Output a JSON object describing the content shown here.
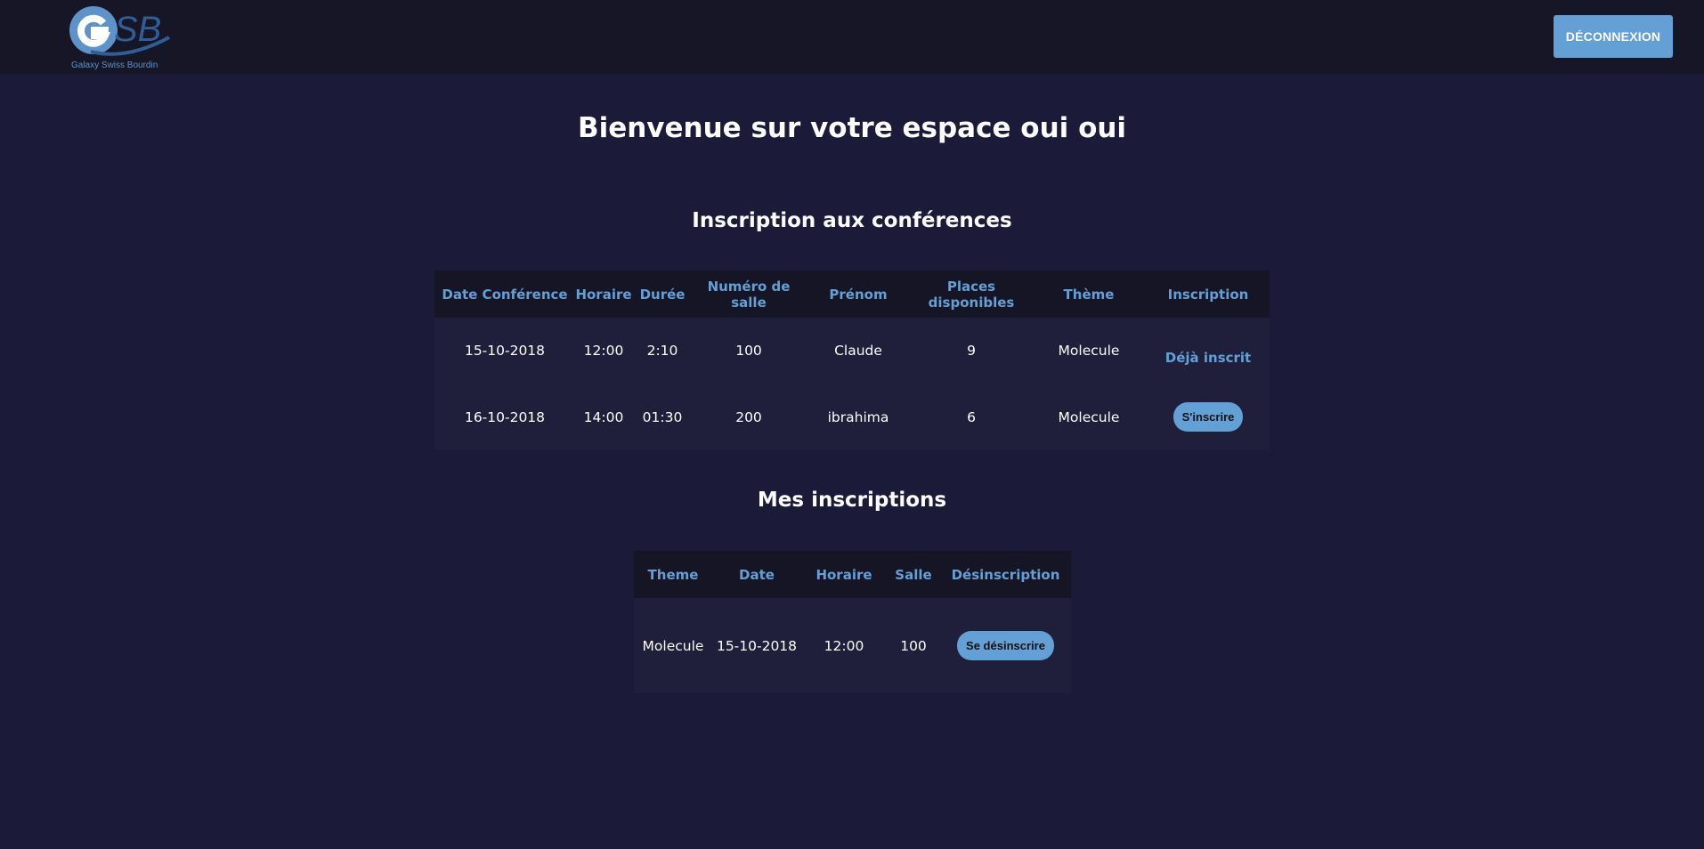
{
  "header": {
    "logo_letters": "GSB",
    "logo_text": "Galaxy Swiss Bourdin",
    "logout_label": "DÉCONNEXION"
  },
  "page_title": "Bienvenue sur votre espace oui oui",
  "conferences": {
    "title": "Inscription aux conférences",
    "columns": [
      "Date Conférence",
      "Horaire",
      "Durée",
      "Numéro de salle",
      "Prénom",
      "Places disponibles",
      "Thème",
      "Inscription"
    ],
    "rows": [
      {
        "date": "15-10-2018",
        "horaire": "12:00",
        "duree": "2:10",
        "salle": "100",
        "prenom": "Claude",
        "places": "9",
        "theme": "Molecule",
        "inscription": "Déjà inscrit"
      },
      {
        "date": "16-10-2018",
        "horaire": "14:00",
        "duree": "01:30",
        "salle": "200",
        "prenom": "ibrahima",
        "places": "6",
        "theme": "Molecule",
        "inscription": "S'inscrire"
      }
    ]
  },
  "my_registrations": {
    "title": "Mes inscriptions",
    "columns": [
      "Theme",
      "Date",
      "Horaire",
      "Salle",
      "Désinscription"
    ],
    "rows": [
      {
        "theme": "Molecule",
        "date": "15-10-2018",
        "horaire": "12:00",
        "salle": "100",
        "action": "Se désinscrire"
      }
    ]
  },
  "colors": {
    "background": "#1b1a39",
    "topbar": "#161626",
    "accent": "#62a0d6",
    "table_header": "#151525",
    "table_row": "#1f1e3b"
  }
}
